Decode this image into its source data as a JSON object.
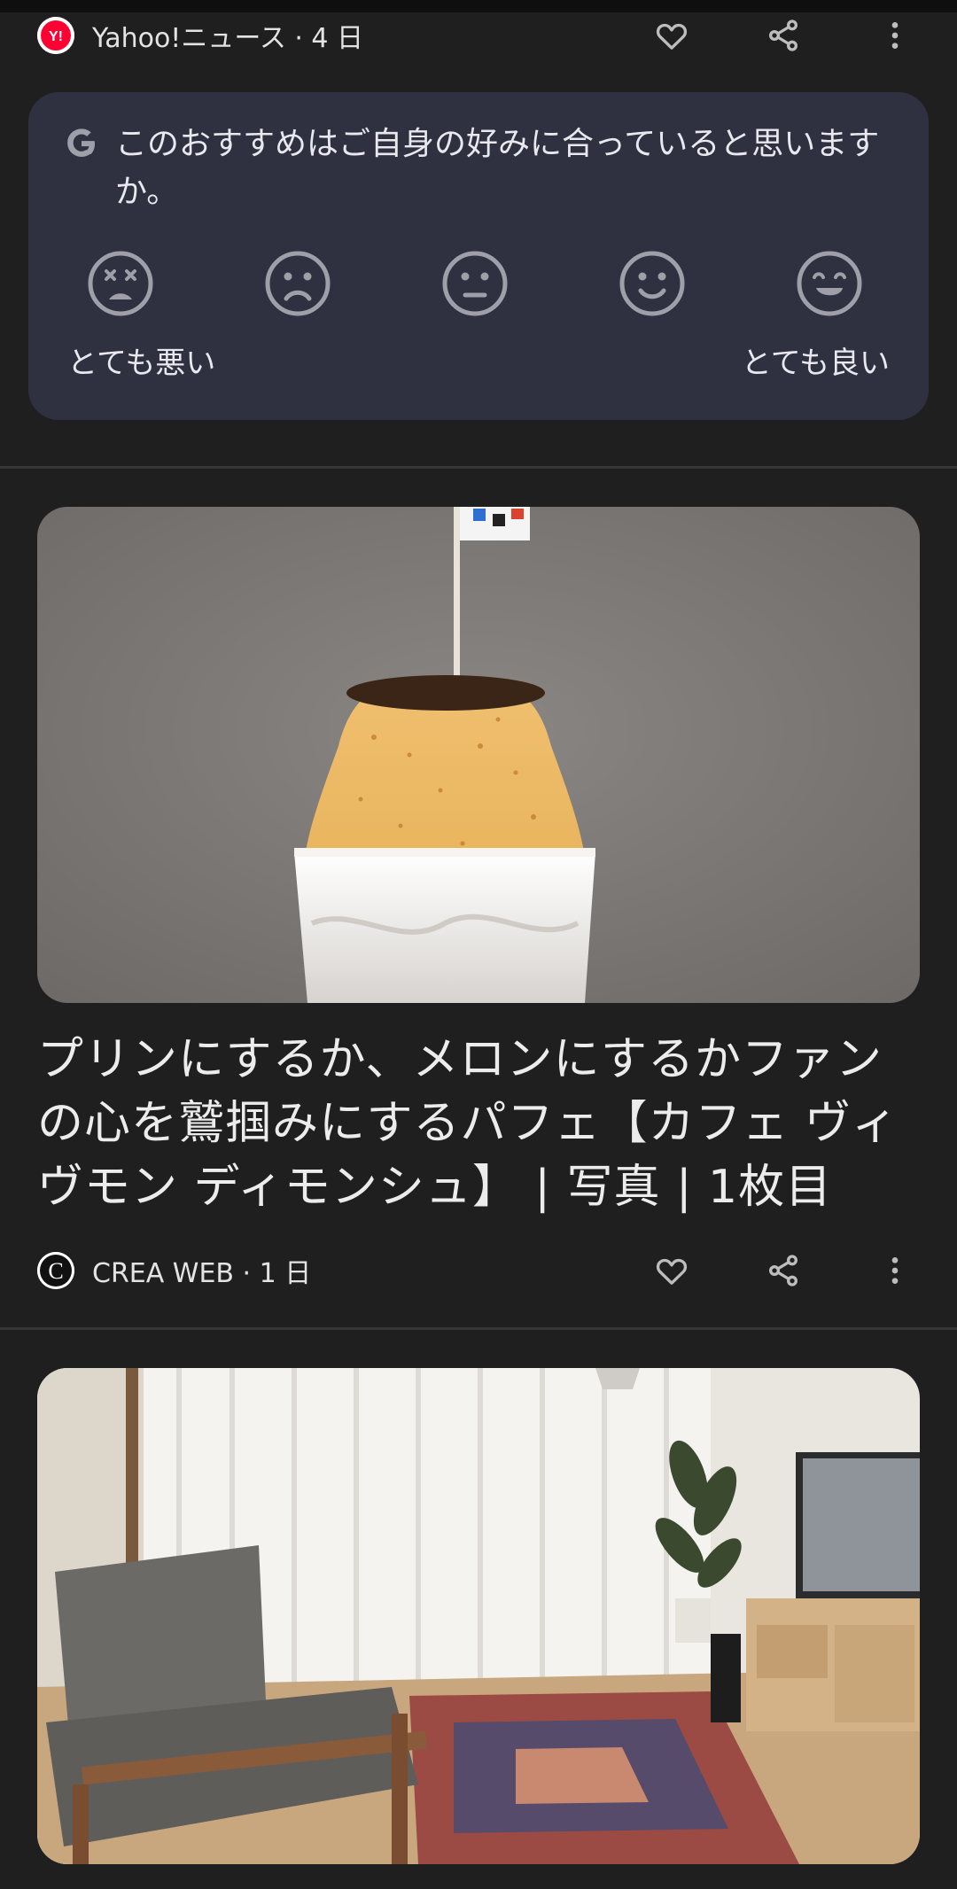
{
  "item1": {
    "source": "Yahoo!ニュース · 4 日",
    "logo_letter": "Y!"
  },
  "feedback": {
    "question": "このおすすめはご自身の好みに合っていると思いますか。",
    "options": [
      "very-bad",
      "bad",
      "neutral",
      "good",
      "very-good"
    ],
    "label_low": "とても悪い",
    "label_high": "とても良い"
  },
  "item2": {
    "title": "プリンにするか、メロンにするかファンの心を鷲掴みにするパフェ【カフェ ヴィヴモン ディモンシュ】 | 写真 | 1枚目",
    "source": "CREA WEB · 1 日",
    "logo_letter": "C"
  },
  "colors": {
    "background": "#1f1f1f",
    "card": "#2f3040",
    "icon": "#bdbdbd",
    "yahoo_red": "#ff0033"
  }
}
